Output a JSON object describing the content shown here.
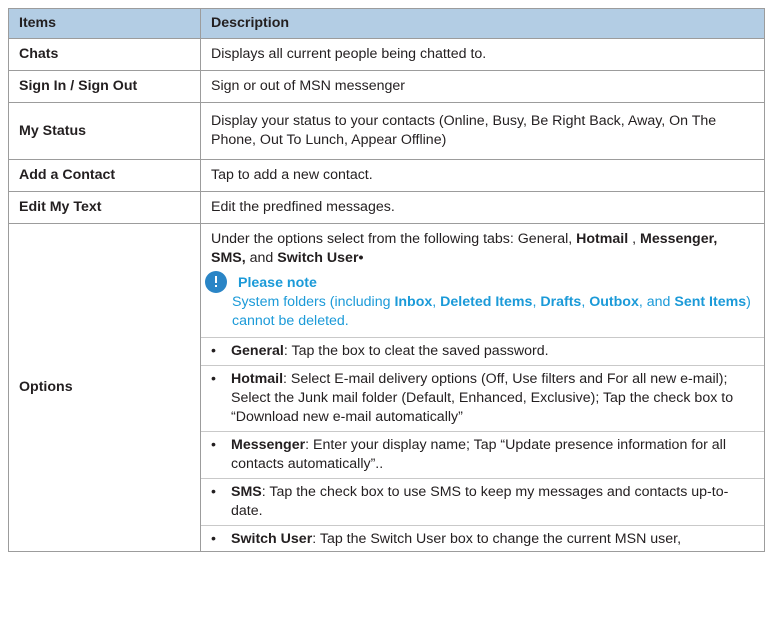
{
  "header": {
    "items": "Items",
    "description": "Description"
  },
  "rows": {
    "chats": {
      "item": "Chats",
      "desc": "Displays all current people being chatted to."
    },
    "sign": {
      "item": "Sign In / Sign Out",
      "desc": "Sign or out of MSN messenger"
    },
    "status": {
      "item": "My Status",
      "desc": "Display your status to your contacts (Online, Busy, Be Right Back, Away, On The Phone, Out To Lunch, Appear Offline)"
    },
    "add": {
      "item": "Add a Contact",
      "desc": "Tap to add a new contact."
    },
    "edit": {
      "item": "Edit My Text",
      "desc": "Edit the predfined messages."
    },
    "options": {
      "item": "Options",
      "intro": {
        "prefix": "Under the options select from the following tabs: General, ",
        "hotmail": "Hotmail",
        "sep1": " , ",
        "messenger_sms": "Messenger, SMS,",
        "sep2": " and ",
        "switch": "Switch User•"
      },
      "note": {
        "title": "Please note",
        "t1": "System folders (including ",
        "inbox": "Inbox",
        "t2": ", ",
        "deleted": "Deleted Items",
        "t3": ", ",
        "drafts": "Drafts",
        "t4": ", ",
        "outbox": "Outbox",
        "t5": ", and ",
        "sent": "Sent Items",
        "t6": ") cannot be deleted."
      },
      "bullets": [
        {
          "label": "General",
          "text": ": Tap the box to cleat the saved password."
        },
        {
          "label": "Hotmail",
          "text": ": Select E-mail delivery options (Off, Use filters and For all new e-mail);  Select the Junk mail folder (Default, Enhanced, Exclusive); Tap the check box to “Download new e-mail automatically”"
        },
        {
          "label": "Messenger",
          "text": ": Enter your display name; Tap “Update presence information for all contacts automatically”.."
        },
        {
          "label": "SMS",
          "text": ": Tap the check box to use SMS to keep my messages and contacts up-to-date."
        },
        {
          "label": "Switch User",
          "text": ": Tap the Switch User box to change the current MSN user,"
        }
      ]
    }
  },
  "colors": {
    "header_bg": "#b3cde4",
    "note_text": "#1b9ad8",
    "note_icon": "#2a85c6",
    "border": "#9c9c9c"
  },
  "icons": {
    "note": "info-icon"
  }
}
